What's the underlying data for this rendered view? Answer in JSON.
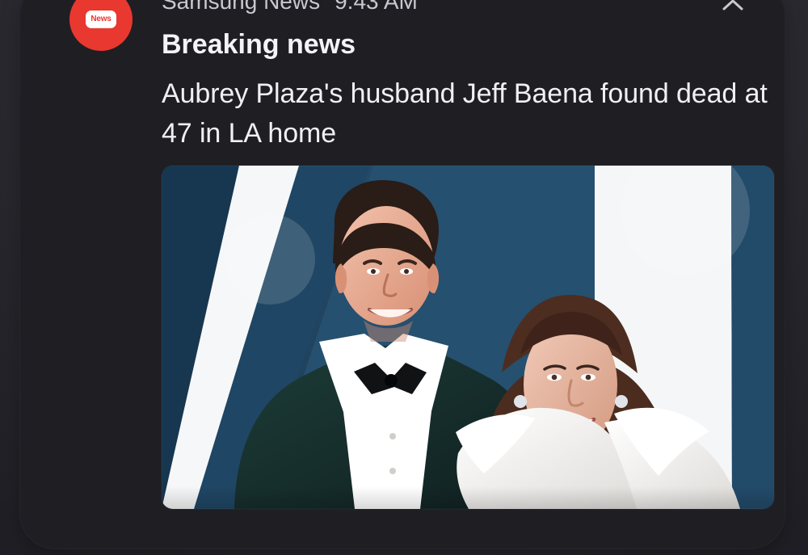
{
  "notification": {
    "app_name": "Samsung News",
    "time": "9:43 AM",
    "title": "Breaking news",
    "body": "Aubrey Plaza's husband Jeff Baena found dead at 47 in LA home",
    "app_icon_text": "News",
    "icon_names": {
      "app_icon": "news-icon",
      "collapse_icon": "chevron-up-icon",
      "image": "news-photo"
    },
    "colors": {
      "background": "#2b2a2f",
      "card": "#1f1e23",
      "accent_red": "#e9382f",
      "text_primary": "#f4f3f7",
      "text_secondary": "#c9c8ce"
    }
  }
}
